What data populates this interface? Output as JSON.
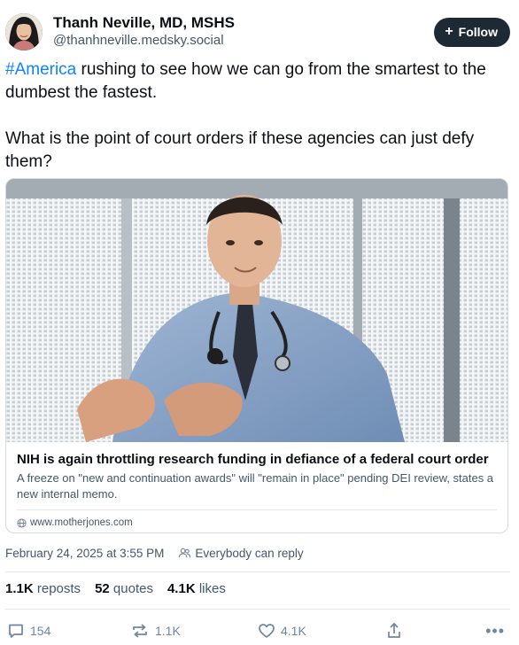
{
  "author": {
    "name": "Thanh Neville, MD, MSHS",
    "handle": "@thanhneville.medsky.social",
    "avatar_icon": "avatar-photo"
  },
  "follow_button": {
    "label": "Follow",
    "icon": "plus-icon"
  },
  "post": {
    "hashtag": "#America",
    "line1_rest": " rushing to see how we can go from the smartest to the dumbest the fastest.",
    "line2": "What is the point of court orders if these agencies can just defy them?"
  },
  "link_card": {
    "title": "NIH is again throttling research funding in defiance of a federal court order",
    "description": "A freeze on \"new and continuation awards\" will \"remain in place\" pending DEI review, states a new internal memo.",
    "domain": "www.motherjones.com",
    "image_icon": "photo-doctor-with-stethoscope"
  },
  "meta": {
    "timestamp": "February 24, 2025 at 3:55 PM",
    "reply_setting": "Everybody can reply"
  },
  "stats": {
    "reposts_count": "1.1K",
    "reposts_label": "reposts",
    "quotes_count": "52",
    "quotes_label": "quotes",
    "likes_count": "4.1K",
    "likes_label": "likes"
  },
  "actions": {
    "reply_count": "154",
    "repost_count": "1.1K",
    "like_count": "4.1K",
    "more_label": "•••"
  },
  "colors": {
    "accent": "#1083fe",
    "follow_bg": "#1e2936",
    "muted_text": "#42576c",
    "icon_gray": "#6f869f"
  }
}
